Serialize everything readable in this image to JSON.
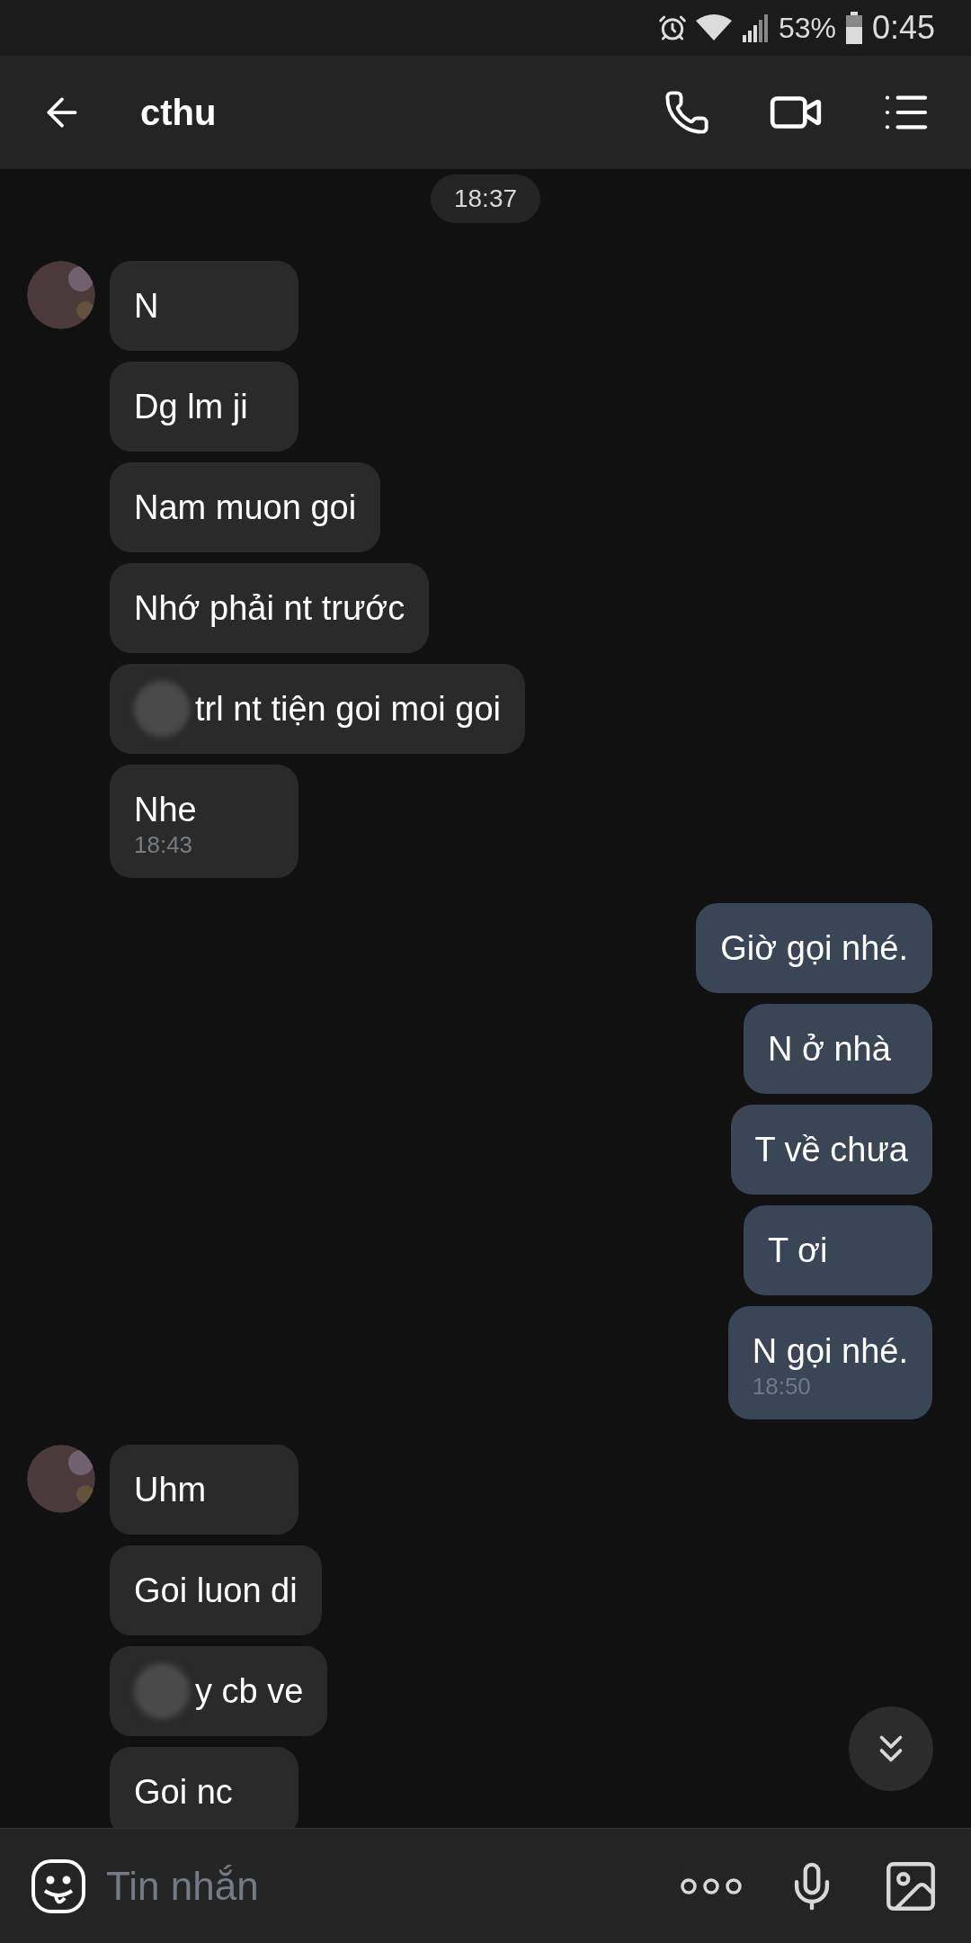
{
  "status_bar": {
    "battery": "53%",
    "time": "0:45"
  },
  "header": {
    "title": "cthu"
  },
  "time_chip": "18:37",
  "messages": [
    {
      "kind": "incoming",
      "avatar": true,
      "text": "N"
    },
    {
      "kind": "incoming",
      "avatar": false,
      "text": "Dg lm ji"
    },
    {
      "kind": "incoming",
      "avatar": false,
      "text": "Nam muon goi"
    },
    {
      "kind": "incoming",
      "avatar": false,
      "text": "Nhớ phải nt trước"
    },
    {
      "kind": "incoming",
      "avatar": false,
      "redacted": true,
      "text": "trl  nt tiện goi moi goi"
    },
    {
      "kind": "incoming",
      "avatar": false,
      "text": "Nhe",
      "time": "18:43"
    },
    {
      "kind": "outgoing",
      "text": "Giờ gọi nhé."
    },
    {
      "kind": "outgoing",
      "text": "N ở nhà"
    },
    {
      "kind": "outgoing",
      "text": "T về chưa"
    },
    {
      "kind": "outgoing",
      "text": "T ơi"
    },
    {
      "kind": "outgoing",
      "text": "N gọi nhé.",
      "time": "18:50"
    },
    {
      "kind": "incoming",
      "avatar": true,
      "text": "Uhm"
    },
    {
      "kind": "incoming",
      "avatar": false,
      "text": "Goi luon di"
    },
    {
      "kind": "incoming",
      "avatar": false,
      "redacted": true,
      "text": "y cb ve"
    },
    {
      "kind": "incoming",
      "avatar": false,
      "text": "Goi nc"
    }
  ],
  "composer": {
    "placeholder": "Tin nhắn"
  }
}
